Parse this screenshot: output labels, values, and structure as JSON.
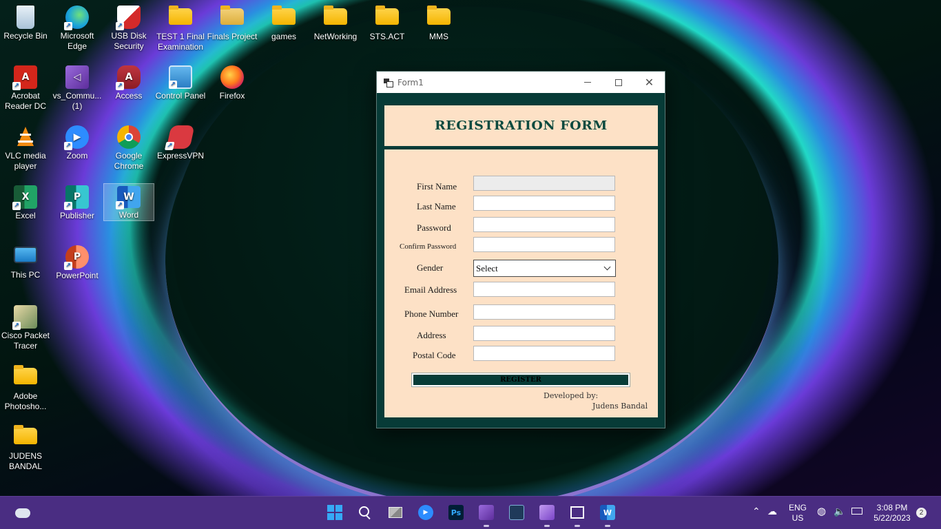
{
  "desktop": {
    "icons": [
      {
        "label": "Recycle Bin",
        "icon": "recycle-bin-icon"
      },
      {
        "label": "Microsoft Edge",
        "icon": "edge-icon"
      },
      {
        "label": "USB Disk Security",
        "icon": "usb-disk-security-icon"
      },
      {
        "label": "TEST 1 Final Examination",
        "icon": "folder-icon"
      },
      {
        "label": "Finals Project",
        "icon": "zip-folder-icon"
      },
      {
        "label": "games",
        "icon": "folder-icon"
      },
      {
        "label": "NetWorking",
        "icon": "folder-icon"
      },
      {
        "label": "STS.ACT",
        "icon": "folder-icon"
      },
      {
        "label": "MMS",
        "icon": "folder-icon"
      },
      {
        "label": "Acrobat Reader DC",
        "icon": "acrobat-icon"
      },
      {
        "label": "vs_Commu... (1)",
        "icon": "visual-studio-installer-icon"
      },
      {
        "label": "Access",
        "icon": "access-icon"
      },
      {
        "label": "Control Panel",
        "icon": "control-panel-icon"
      },
      {
        "label": "Firefox",
        "icon": "firefox-icon"
      },
      {
        "label": "VLC media player",
        "icon": "vlc-icon"
      },
      {
        "label": "Zoom",
        "icon": "zoom-icon"
      },
      {
        "label": "Google Chrome",
        "icon": "chrome-icon"
      },
      {
        "label": "ExpressVPN",
        "icon": "expressvpn-icon"
      },
      {
        "label": "Excel",
        "icon": "excel-icon"
      },
      {
        "label": "Publisher",
        "icon": "publisher-icon"
      },
      {
        "label": "Word",
        "icon": "word-icon"
      },
      {
        "label": "This PC",
        "icon": "this-pc-icon"
      },
      {
        "label": "PowerPoint",
        "icon": "powerpoint-icon"
      },
      {
        "label": "Cisco Packet Tracer",
        "icon": "cisco-packet-tracer-icon"
      },
      {
        "label": "Adobe Photosho...",
        "icon": "folder-icon"
      },
      {
        "label": "JUDENS BANDAL",
        "icon": "folder-icon"
      }
    ]
  },
  "window": {
    "title": "Form1",
    "form_title": "REGISTRATION FORM",
    "fields": {
      "first_name": "First Name",
      "last_name": "Last Name",
      "password": "Password",
      "confirm_password": "Confirm Password",
      "gender": "Gender",
      "email": "Email Address",
      "phone": "Phone Number",
      "address": "Address",
      "postal_code": "Postal Code"
    },
    "gender_selected": "Select",
    "register_label": "REGISTER",
    "developed_by": "Developed by:",
    "developer": "Judens Bandal"
  },
  "taskbar": {
    "apps": [
      "start-icon",
      "search-icon",
      "task-view-icon",
      "zoom-icon",
      "photoshop-icon",
      "visual-studio-installer-icon",
      "packet-tracer-icon",
      "visual-studio-icon",
      "form-app-icon",
      "word-icon"
    ],
    "photoshop_label": "Ps",
    "language": "ENG",
    "region": "US",
    "time": "3:08 PM",
    "date": "5/22/2023",
    "notification_count": "2"
  },
  "colors": {
    "form_bg": "#fde1c6",
    "window_frame": "#073b37",
    "title_text": "#0b4a3f",
    "taskbar": "#4a2d82"
  }
}
